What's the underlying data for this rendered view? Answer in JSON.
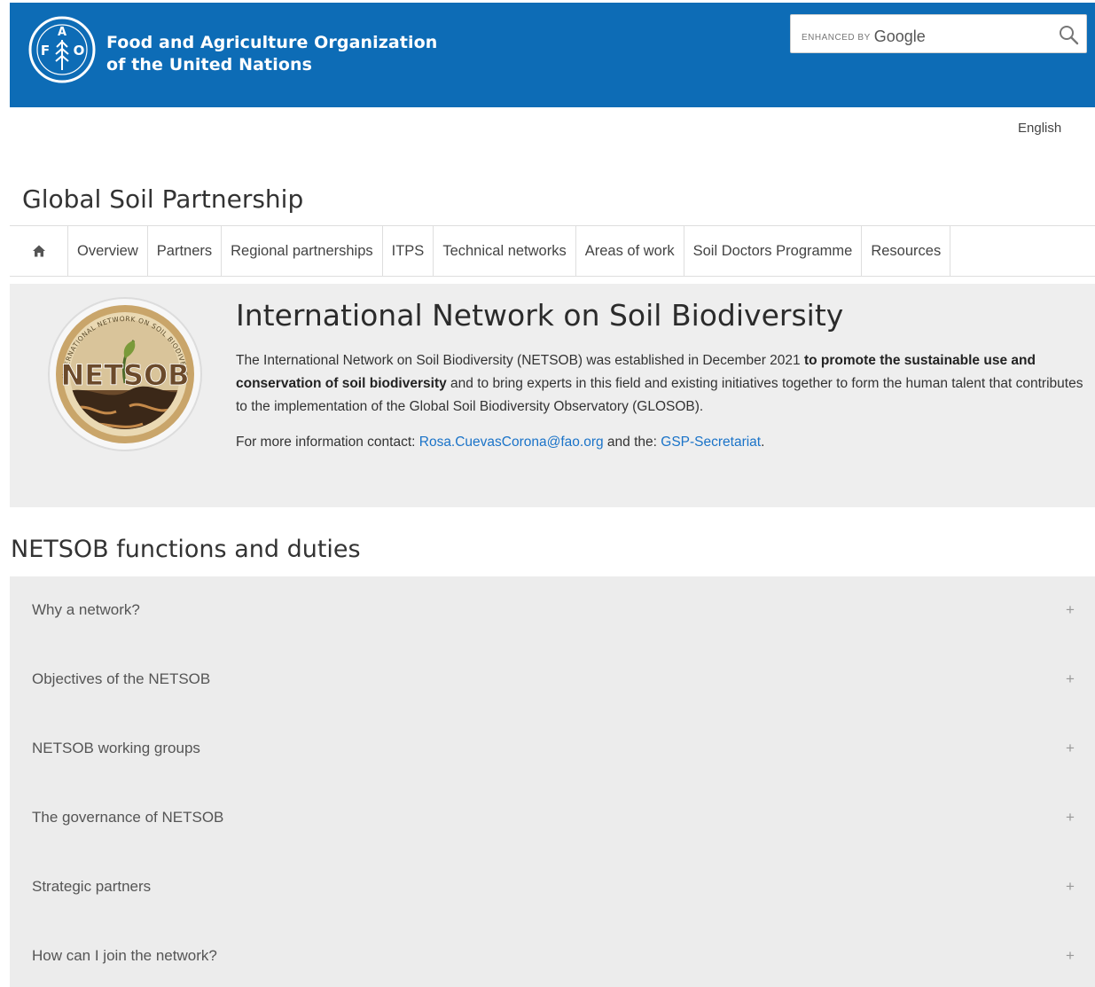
{
  "header": {
    "org_line1": "Food and Agriculture Organization",
    "org_line2": "of the United Nations",
    "search_brand_prefix": "ENHANCED BY",
    "search_brand_google": "Google",
    "brand_color": "#0d6cb6"
  },
  "language": "English",
  "site_title": "Global Soil Partnership",
  "nav": {
    "home_icon": "home-icon",
    "items": [
      {
        "label": "Overview"
      },
      {
        "label": "Partners"
      },
      {
        "label": "Regional partnerships"
      },
      {
        "label": "ITPS"
      },
      {
        "label": "Technical networks"
      },
      {
        "label": "Areas of work"
      },
      {
        "label": "Soil Doctors Programme"
      },
      {
        "label": "Resources"
      }
    ]
  },
  "intro": {
    "logo_text": "NETSOB",
    "logo_ring_text": "INTERNATIONAL NETWORK ON SOIL BIODIVERSITY",
    "title": "International Network on Soil Biodiversity",
    "text_a": "The International Network on Soil Biodiversity (NETSOB) was established in December 2021 ",
    "text_bold": "to promote the sustainable use and conservation of soil biodiversity",
    "text_b": " and to bring experts in this field and existing initiatives together to form the human talent that contributes to the implementation of the Global Soil Biodiversity Observatory (GLOSOB).",
    "contact_prefix": "For more information contact: ",
    "contact_email": "Rosa.CuevasCorona@fao.org",
    "contact_middle": " and the: ",
    "contact_secretariat": "GSP-Secretariat",
    "contact_suffix": "."
  },
  "section_title": "NETSOB functions and duties",
  "accordion": {
    "expand_symbol": "+",
    "items": [
      {
        "label": "Why a network?"
      },
      {
        "label": "Objectives of the NETSOB"
      },
      {
        "label": "NETSOB working groups"
      },
      {
        "label": "The governance of NETSOB"
      },
      {
        "label": "Strategic partners"
      },
      {
        "label": "How can I join the network?"
      }
    ]
  }
}
